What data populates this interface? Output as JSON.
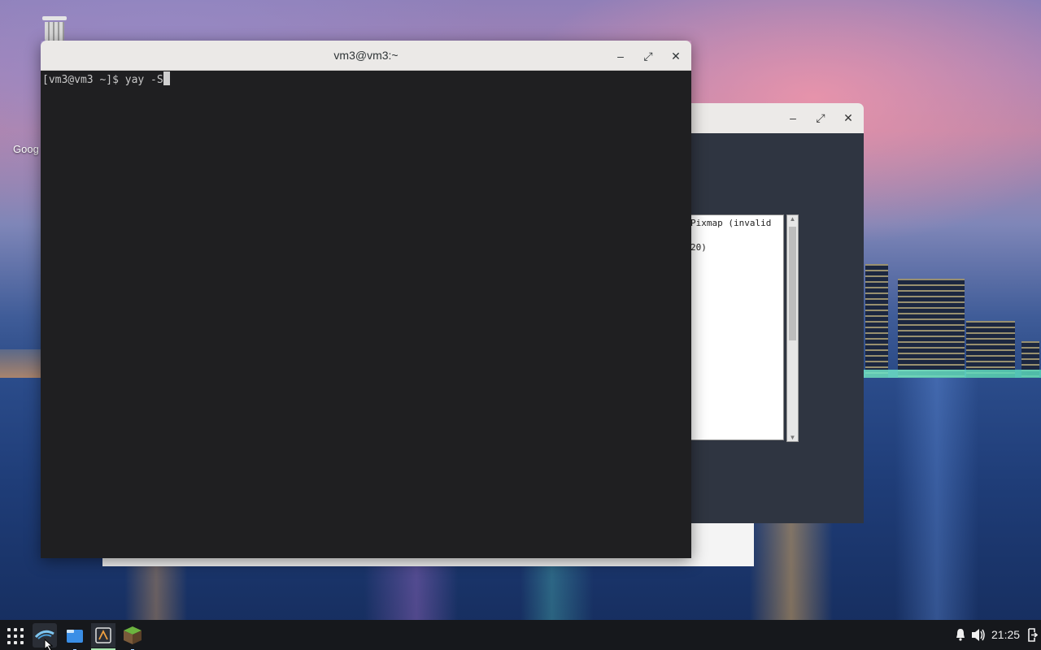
{
  "desktop": {
    "trash_label": "",
    "chrome_label": "Goog"
  },
  "terminal": {
    "title": "vm3@vm3:~",
    "prompt": "[vm3@vm3 ~]$ ",
    "command": "yay -S",
    "controls": {
      "minimize": "–",
      "maximize": "⤢",
      "close": "✕"
    }
  },
  "back_window": {
    "controls": {
      "minimize": "–",
      "maximize": "⤢",
      "close": "✕"
    },
    "text_line1": "Pixmap (invalid",
    "text_line2": "20)"
  },
  "taskbar": {
    "apps": [
      "app-launcher",
      "browser",
      "file-manager",
      "terminal",
      "minecraft"
    ],
    "clock": "21:25",
    "status_icons": [
      "bell-icon",
      "volume-icon",
      "logout-icon"
    ]
  },
  "colors": {
    "terminal_bg": "#1f1f21",
    "titlebar_bg": "#ebe9e7",
    "taskbar_bg": "#16181c",
    "back_window_bg": "#2f3541"
  }
}
